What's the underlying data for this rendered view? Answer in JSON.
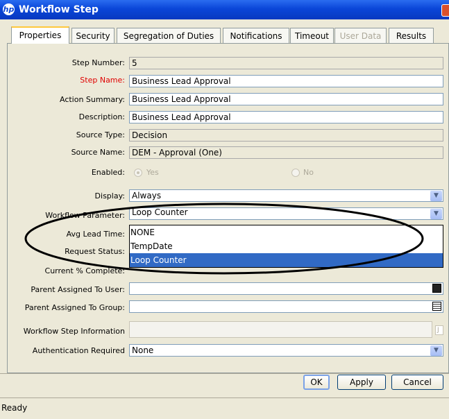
{
  "window": {
    "title": "Workflow Step"
  },
  "tabs": [
    {
      "label": "Properties"
    },
    {
      "label": "Security"
    },
    {
      "label": "Segregation of Duties"
    },
    {
      "label": "Notifications"
    },
    {
      "label": "Timeout"
    },
    {
      "label": "User Data"
    },
    {
      "label": "Results"
    }
  ],
  "form": {
    "step_number": {
      "label": "Step Number:",
      "value": "5"
    },
    "step_name": {
      "label": "Step Name:",
      "value": "Business Lead Approval"
    },
    "action_summary": {
      "label": "Action Summary:",
      "value": "Business Lead Approval"
    },
    "description": {
      "label": "Description:",
      "value": "Business Lead Approval"
    },
    "source_type": {
      "label": "Source Type:",
      "value": "Decision"
    },
    "source_name": {
      "label": "Source Name:",
      "value": "DEM - Approval (One)"
    },
    "enabled": {
      "label": "Enabled:",
      "yes": "Yes",
      "no": "No"
    },
    "display": {
      "label": "Display:",
      "value": "Always"
    },
    "workflow_parameter": {
      "label": "Workflow Parameter:",
      "value": "Loop Counter"
    },
    "avg_lead_time": {
      "label": "Avg Lead Time:"
    },
    "request_status": {
      "label": "Request Status:"
    },
    "current_complete": {
      "label": "Current % Complete:"
    },
    "parent_assigned_user": {
      "label": "Parent Assigned To User:",
      "value": ""
    },
    "parent_assigned_group": {
      "label": "Parent Assigned To Group:",
      "value": ""
    },
    "workflow_step_info": {
      "label": "Workflow Step Information",
      "value": ""
    },
    "auth_required": {
      "label": "Authentication Required",
      "value": "None"
    }
  },
  "dropdown_options": [
    "NONE",
    "TempDate",
    "Loop Counter"
  ],
  "buttons": {
    "ok": "OK",
    "apply": "Apply",
    "cancel": "Cancel"
  },
  "status": "Ready"
}
